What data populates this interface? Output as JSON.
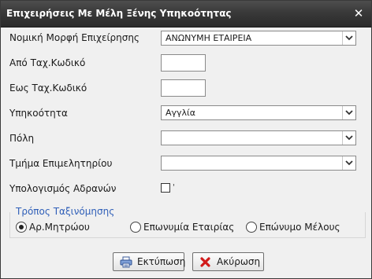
{
  "window": {
    "title": "Επιχειρήσεις Με Μέλη Ξένης Υπηκοότητας",
    "close_glyph": "✕"
  },
  "form": {
    "legal_form": {
      "label": "Νομική Μορφή Επιχείρησης",
      "value": "ΑΝΩΝΥΜΗ ΕΤΑΙΡΕΙΑ"
    },
    "from_code": {
      "label": "Από Ταχ.Κωδικό",
      "value": ""
    },
    "to_code": {
      "label": "Εως Ταχ.Κωδικό",
      "value": ""
    },
    "nationality": {
      "label": "Υπηκοότητα",
      "value": "Αγγλία"
    },
    "city": {
      "label": "Πόλη",
      "value": ""
    },
    "chamber_dept": {
      "label": "Τμήμα Επιμελητηρίου",
      "value": ""
    },
    "inactive": {
      "label": "Υπολογισμός Αδρανών",
      "checked": false,
      "mark": "'"
    }
  },
  "sorting": {
    "title": "Τρόπος Ταξινόμησης",
    "options": [
      {
        "label": "Αρ.Μητρώου",
        "selected": true
      },
      {
        "label": "Επωνυμία Εταιρίας",
        "selected": false
      },
      {
        "label": "Επώνυμο Μέλους",
        "selected": false
      }
    ]
  },
  "buttons": {
    "print_label": "Εκτύπωση",
    "cancel_label": "Ακύρωση"
  },
  "icons": {
    "close": "close-icon",
    "print": "printer-icon",
    "cancel": "red-x-icon",
    "dropdown": "chevron-down-icon"
  },
  "colors": {
    "titlebar": "#333333",
    "group_title": "#2f5fb8",
    "cancel_icon": "#d11a1a"
  }
}
